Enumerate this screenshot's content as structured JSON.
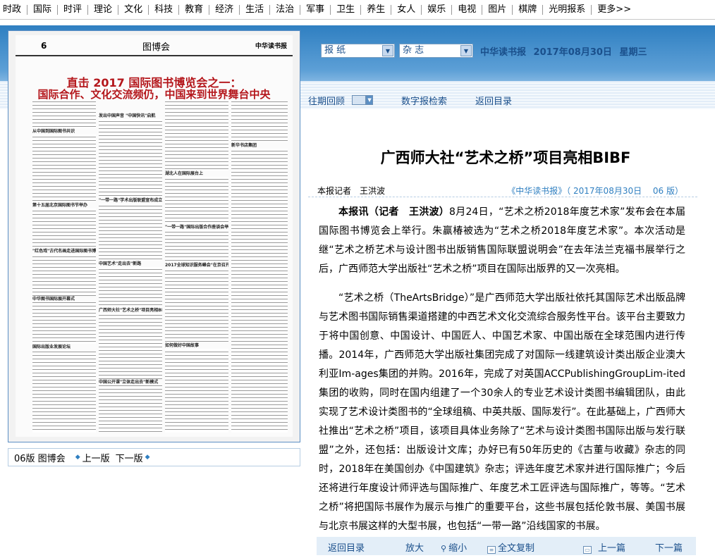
{
  "topnav": [
    "时政",
    "国际",
    "时评",
    "理论",
    "文化",
    "科技",
    "教育",
    "经济",
    "生活",
    "法治",
    "军事",
    "卫生",
    "养生",
    "女人",
    "娱乐",
    "电视",
    "图片",
    "棋牌",
    "光明报系",
    "更多>>"
  ],
  "newspaper": {
    "page_number": "6",
    "section": "图博会",
    "brand": "中华读书报",
    "headline_line1": "直击 2017 国际图书博览会之一：",
    "headline_line2": "国际合作、文化交流频仍，中国来到世界舞台中央",
    "col1_heads": [
      "从中国到国际图书共识",
      "第十五届北京国际图书节举办",
      "\"红色戏\"古代名画走进国际图书博览会",
      "中华图书国际展开幕式",
      "国际出版业发展论坛"
    ],
    "col2_heads": [
      "发出中国声音 \"中国快讯\"启航",
      "\"一带一路\"学术出版联盟宣布成立",
      "中国艺术\"走出去\"新路",
      "广西师大社\"艺术之桥\"项目亮相BIBF",
      "中国公开课\"立体走出去\"新模式"
    ],
    "col3_heads": [
      "湖北人在国际展台上",
      "\"一带一路\"国际出版合作座谈会举行",
      "2017全球知识服务峰会\"在京召开",
      "如何做好中国故事"
    ],
    "col4_heads": [
      "新华书店集团"
    ]
  },
  "pager": {
    "label": "06版 图博会",
    "prev": "上一版",
    "next": "下一版"
  },
  "selects": {
    "paper": "报  纸",
    "magazine": "杂  志"
  },
  "paper_info": {
    "name": "中华读书报",
    "date": "2017年08月30日",
    "weekday": "星期三"
  },
  "subnav": {
    "past_issues": "往期回顾",
    "digital_search": "数字报检索",
    "back_to_index": "返回目录"
  },
  "article": {
    "title": "广西师大社“艺术之桥”项目亮相BIBF",
    "author": "本报记者　王洪波",
    "source": "《中华读书报》（ 2017年08月30日　 06 版）",
    "lead": "本报讯（记者　王洪波）",
    "para1": "8月24日，“艺术之桥2018年度艺术家”发布会在本届国际图书博览会上举行。朱赢椿被选为“艺术之桥2018年度艺术家”。本次活动是继“艺术之桥艺术与设计图书出版销售国际联盟说明会”在去年法兰克福书展举行之后，广西师范大学出版社“艺术之桥”项目在国际出版界的又一次亮相。",
    "para2": "“艺术之桥（TheArtsBridge）”是广西师范大学出版社依托其国际艺术出版品牌与艺术图书国际销售渠道搭建的中西艺术文化交流综合服务性平台。该平台主要致力于将中国创意、中国设计、中国匠人、中国艺术家、中国出版在全球范围内进行传播。2014年，广西师范大学出版社集团完成了对国际一线建筑设计类出版企业澳大利亚Im-ages集团的并购。2016年，完成了对英国ACCPublishingGroupLim-ited集团的收购，同时在国内组建了一个30余人的专业艺术设计类图书编辑团队，由此实现了艺术设计类图书的“全球组稿、中英共版、国际发行”。在此基础上，广西师大社推出“艺术之桥”项目，该项目具体业务除了“艺术与设计类图书国际出版与发行联盟”之外，还包括：出版设计文库；办好已有50年历史的《古董与收藏》杂志的同时，2018年在美国创办《中国建筑》杂志；评选年度艺术家并进行国际推广；今后还将进行年度设计师评选与国际推广、年度艺术工匠评选与国际推广，等等。“艺术之桥”将把国际书展作为展示与推广的重要平台，这些书展包括伦敦书展、美国书展与北京书展这样的大型书展，也包括“一带一路”沿线国家的书展。"
  },
  "toolbar": {
    "back_to_index": "返回目录",
    "zoom_in": "放大",
    "zoom_out": "缩小",
    "copy_all": "全文复制",
    "prev": "上一篇",
    "next": "下一篇"
  }
}
